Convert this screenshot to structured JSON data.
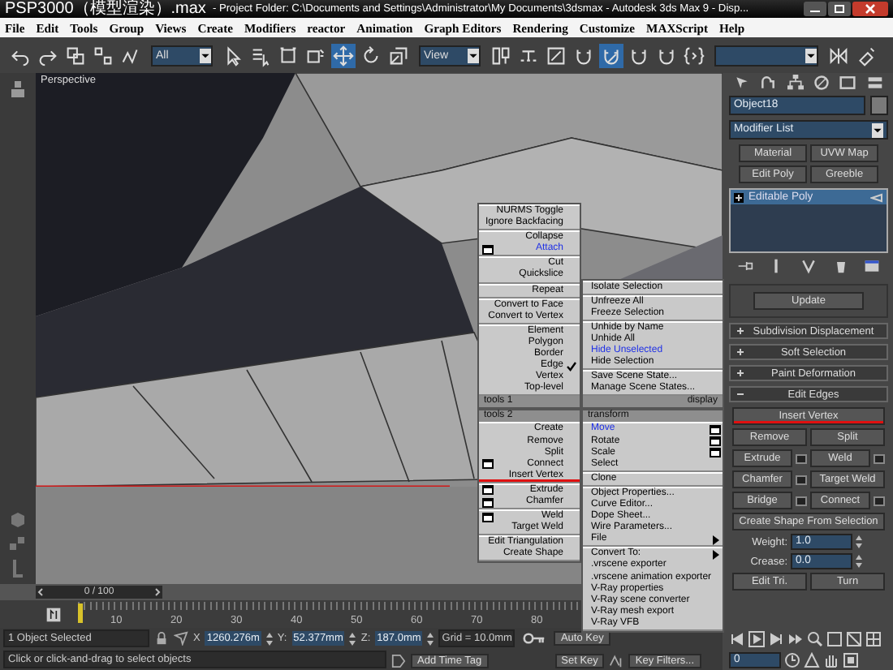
{
  "title_bar": {
    "file_name": "PSP3000（模型渲染）.max",
    "title": "- Project Folder: C:\\Documents and Settings\\Administrator\\My Documents\\3dsmax   - Autodesk 3ds Max 9   - Disp..."
  },
  "menu_bar": [
    "File",
    "Edit",
    "Tools",
    "Group",
    "Views",
    "Create",
    "Modifiers",
    "reactor",
    "Animation",
    "Graph Editors",
    "Rendering",
    "Customize",
    "MAXScript",
    "Help"
  ],
  "toolbar": {
    "selection_filter": "All",
    "reference_coordinate_system": "View",
    "tools": [
      {
        "selected": false
      },
      {
        "selected": false
      },
      {
        "selected": false
      },
      {
        "selected": false
      },
      {
        "selected": false
      },
      {
        "selected": false
      },
      {
        "selected": false
      },
      {
        "selected": false
      },
      {
        "selected": false
      },
      {
        "selected": true
      },
      {
        "selected": false
      },
      {
        "selected": false
      },
      {
        "selected": false
      },
      {
        "selected": false
      },
      {
        "selected": false
      },
      {
        "selected": false
      },
      {
        "selected": true
      },
      {
        "selected": false
      },
      {
        "selected": false
      },
      {
        "selected": false
      },
      {
        "selected": false
      },
      {
        "selected": false
      }
    ]
  },
  "viewport": {
    "label": "Perspective"
  },
  "quad_menu": {
    "quadrants": [
      {
        "header": "tools 1",
        "groups": [
          [
            {
              "label": "NURMS Toggle",
              "kind": "plain",
              "checked": false,
              "last_used": false,
              "underlined": false
            },
            {
              "label": "Ignore Backfacing",
              "kind": "plain",
              "checked": false,
              "last_used": false,
              "underlined": false
            }
          ],
          [
            {
              "label": "Collapse",
              "kind": "plain",
              "checked": false,
              "last_used": false,
              "underlined": false
            },
            {
              "label": "Attach",
              "kind": "options",
              "checked": false,
              "last_used": true,
              "underlined": false
            }
          ],
          [
            {
              "label": "Cut",
              "kind": "plain",
              "checked": false,
              "last_used": false,
              "underlined": false
            },
            {
              "label": "Quickslice",
              "kind": "plain",
              "checked": false,
              "last_used": false,
              "underlined": false
            }
          ],
          [
            {
              "label": "Repeat",
              "kind": "plain",
              "checked": false,
              "last_used": false,
              "underlined": false
            }
          ],
          [
            {
              "label": "Convert to Face",
              "kind": "plain",
              "checked": false,
              "last_used": false,
              "underlined": false
            },
            {
              "label": "Convert to Vertex",
              "kind": "plain",
              "checked": false,
              "last_used": false,
              "underlined": false
            }
          ],
          [
            {
              "label": "Element",
              "kind": "plain",
              "checked": false,
              "last_used": false,
              "underlined": false
            },
            {
              "label": "Polygon",
              "kind": "plain",
              "checked": false,
              "last_used": false,
              "underlined": false
            },
            {
              "label": "Border",
              "kind": "plain",
              "checked": false,
              "last_used": false,
              "underlined": false
            },
            {
              "label": "Edge",
              "kind": "plain",
              "checked": true,
              "last_used": false,
              "underlined": false
            },
            {
              "label": "Vertex",
              "kind": "plain",
              "checked": false,
              "last_used": false,
              "underlined": false
            },
            {
              "label": "Top-level",
              "kind": "plain",
              "checked": false,
              "last_used": false,
              "underlined": false
            }
          ]
        ]
      },
      {
        "header": "display",
        "groups": [
          [
            {
              "label": "Isolate Selection",
              "kind": "plain",
              "checked": false,
              "last_used": false,
              "underlined": false
            }
          ],
          [
            {
              "label": "Unfreeze All",
              "kind": "plain",
              "checked": false,
              "last_used": false,
              "underlined": false
            },
            {
              "label": "Freeze Selection",
              "kind": "plain",
              "checked": false,
              "last_used": false,
              "underlined": false
            }
          ],
          [
            {
              "label": "Unhide by Name",
              "kind": "plain",
              "checked": false,
              "last_used": false,
              "underlined": false
            },
            {
              "label": "Unhide All",
              "kind": "plain",
              "checked": false,
              "last_used": false,
              "underlined": false
            },
            {
              "label": "Hide Unselected",
              "kind": "plain",
              "checked": false,
              "last_used": true,
              "underlined": false
            },
            {
              "label": "Hide Selection",
              "kind": "plain",
              "checked": false,
              "last_used": false,
              "underlined": false
            }
          ],
          [
            {
              "label": "Save Scene State...",
              "kind": "plain",
              "checked": false,
              "last_used": false,
              "underlined": false
            },
            {
              "label": "Manage Scene States...",
              "kind": "plain",
              "checked": false,
              "last_used": false,
              "underlined": false
            }
          ]
        ]
      },
      {
        "header": "tools 2",
        "groups": [
          [
            {
              "label": "Create",
              "kind": "plain",
              "checked": false,
              "last_used": false,
              "underlined": false
            },
            {
              "label": "Remove",
              "kind": "plain",
              "checked": false,
              "last_used": false,
              "underlined": false
            },
            {
              "label": "Split",
              "kind": "plain",
              "checked": false,
              "last_used": false,
              "underlined": false
            },
            {
              "label": "Connect",
              "kind": "options",
              "checked": false,
              "last_used": false,
              "underlined": false
            },
            {
              "label": "Insert Vertex",
              "kind": "plain",
              "checked": false,
              "last_used": false,
              "underlined": true
            }
          ],
          [
            {
              "label": "Extrude",
              "kind": "options",
              "checked": false,
              "last_used": false,
              "underlined": false
            },
            {
              "label": "Chamfer",
              "kind": "options",
              "checked": false,
              "last_used": false,
              "underlined": false
            }
          ],
          [
            {
              "label": "Weld",
              "kind": "options",
              "checked": false,
              "last_used": false,
              "underlined": false
            },
            {
              "label": "Target Weld",
              "kind": "plain",
              "checked": false,
              "last_used": false,
              "underlined": false
            }
          ],
          [
            {
              "label": "Edit Triangulation",
              "kind": "plain",
              "checked": false,
              "last_used": false,
              "underlined": false
            },
            {
              "label": "Create Shape",
              "kind": "plain",
              "checked": false,
              "last_used": false,
              "underlined": false
            }
          ]
        ]
      },
      {
        "header": "transform",
        "groups": [
          [
            {
              "label": "Move",
              "kind": "options",
              "checked": false,
              "last_used": true,
              "underlined": false
            },
            {
              "label": "Rotate",
              "kind": "options",
              "checked": false,
              "last_used": false,
              "underlined": false
            },
            {
              "label": "Scale",
              "kind": "options",
              "checked": false,
              "last_used": false,
              "underlined": false
            },
            {
              "label": "Select",
              "kind": "plain",
              "checked": false,
              "last_used": false,
              "underlined": false
            }
          ],
          [
            {
              "label": "Clone",
              "kind": "plain",
              "checked": false,
              "last_used": false,
              "underlined": false
            }
          ],
          [
            {
              "label": "Object Properties...",
              "kind": "plain",
              "checked": false,
              "last_used": false,
              "underlined": false
            },
            {
              "label": "Curve Editor...",
              "kind": "plain",
              "checked": false,
              "last_used": false,
              "underlined": false
            },
            {
              "label": "Dope Sheet...",
              "kind": "plain",
              "checked": false,
              "last_used": false,
              "underlined": false
            },
            {
              "label": "Wire Parameters...",
              "kind": "plain",
              "checked": false,
              "last_used": false,
              "underlined": false
            },
            {
              "label": "File",
              "kind": "submenu",
              "checked": false,
              "last_used": false,
              "underlined": false
            }
          ],
          [
            {
              "label": "Convert To:",
              "kind": "submenu",
              "checked": false,
              "last_used": false,
              "underlined": false
            },
            {
              "label": ".vrscene exporter",
              "kind": "plain",
              "checked": false,
              "last_used": false,
              "underlined": false
            },
            {
              "label": ".vrscene animation exporter",
              "kind": "plain",
              "checked": false,
              "last_used": false,
              "underlined": false
            },
            {
              "label": "V-Ray properties",
              "kind": "plain",
              "checked": false,
              "last_used": false,
              "underlined": false
            },
            {
              "label": "V-Ray scene converter",
              "kind": "plain",
              "checked": false,
              "last_used": false,
              "underlined": false
            },
            {
              "label": "V-Ray mesh export",
              "kind": "plain",
              "checked": false,
              "last_used": false,
              "underlined": false
            },
            {
              "label": "V-Ray VFB",
              "kind": "plain",
              "checked": false,
              "last_used": false,
              "underlined": false
            }
          ]
        ]
      }
    ]
  },
  "command_panel": {
    "object_name": "Object18",
    "modifier_list": "Modifier List",
    "modifier_buttons": [
      "Material",
      "UVW Map",
      "Edit Poly",
      "Greeble"
    ],
    "stack": [
      {
        "label": "Editable Poly",
        "selected": true
      }
    ],
    "update_button": "Update",
    "rollouts": [
      {
        "label": "Subdivision Displacement",
        "expanded": false
      },
      {
        "label": "Soft Selection",
        "expanded": false
      },
      {
        "label": "Paint Deformation",
        "expanded": false
      },
      {
        "label": "Edit Edges",
        "expanded": true
      }
    ],
    "edit_edges": {
      "rows": [
        [
          {
            "label": "Insert Vertex",
            "options": false,
            "underlined": true
          }
        ],
        [
          {
            "label": "Remove",
            "options": false,
            "underlined": false
          },
          {
            "label": "Split",
            "options": false,
            "underlined": false
          }
        ],
        [
          {
            "label": "Extrude",
            "options": true,
            "underlined": false
          },
          {
            "label": "Weld",
            "options": true,
            "underlined": false
          }
        ],
        [
          {
            "label": "Chamfer",
            "options": true,
            "underlined": false
          },
          {
            "label": "Target Weld",
            "options": false,
            "underlined": false
          }
        ],
        [
          {
            "label": "Bridge",
            "options": true,
            "underlined": false
          },
          {
            "label": "Connect",
            "options": true,
            "underlined": false
          }
        ],
        [
          {
            "label": "Create Shape From Selection",
            "options": false,
            "underlined": false
          }
        ]
      ],
      "spinners": [
        {
          "label": "Weight:",
          "value": "1.0"
        },
        {
          "label": "Crease:",
          "value": "0.0"
        }
      ],
      "bottom_buttons": [
        "Edit Tri.",
        "Turn"
      ]
    }
  },
  "timeline": {
    "frame_counter": "0 / 100",
    "level": 0,
    "ruler_labels": [
      "10",
      "20",
      "30",
      "40",
      "50",
      "60",
      "70",
      "80"
    ]
  },
  "status_bar": {
    "selection": "1 Object Selected",
    "coordinates": [
      {
        "axis": "X",
        "value": "1260.276m"
      },
      {
        "axis": "Y:",
        "value": "52.377mm"
      },
      {
        "axis": "Z:",
        "value": "187.0mm"
      }
    ],
    "grid": "Grid = 10.0mm",
    "auto_key": "Auto Key",
    "set_key": "Set Key",
    "key_filters": "Key Filters...",
    "prompt": "Click or click-and-drag to select objects",
    "add_time_tag": "Add Time Tag"
  },
  "animation_controls": {
    "current_frame": "0"
  }
}
